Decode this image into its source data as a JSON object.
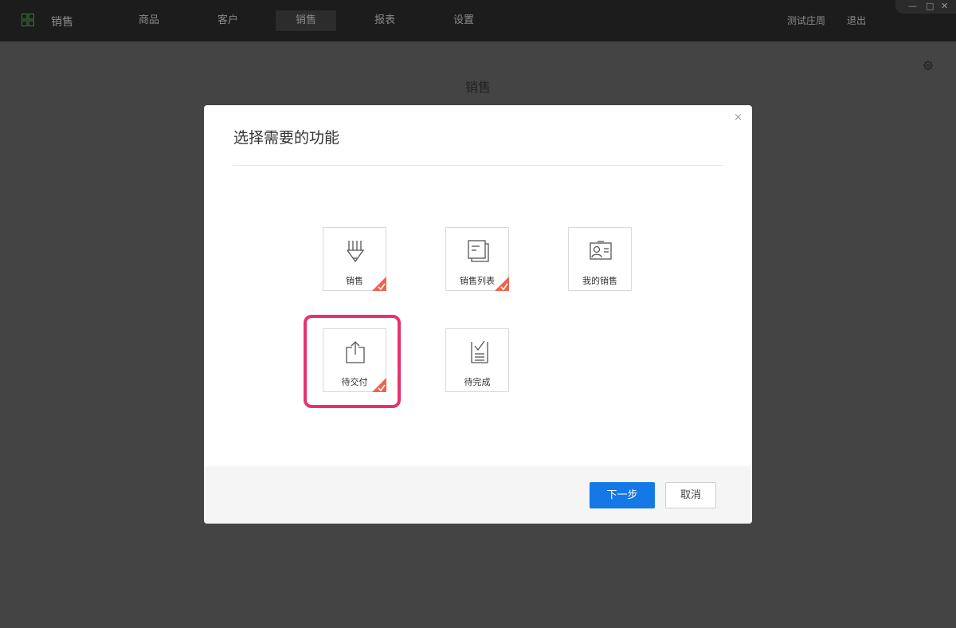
{
  "topbar": {
    "app_name": "销售",
    "nav": [
      "商品",
      "客户",
      "销售",
      "报表",
      "设置"
    ],
    "active_nav": "销售",
    "user": "测试庄周",
    "logout": "退出",
    "window_controls": [
      "—",
      "□",
      "✕"
    ]
  },
  "page": {
    "title": "销售",
    "settings_icon": "gear-icon"
  },
  "modal": {
    "title": "选择需要的功能",
    "close": "×",
    "cards": [
      {
        "label": "销售",
        "icon": "pencil-icon",
        "checked": true
      },
      {
        "label": "销售列表",
        "icon": "document-stack-icon",
        "checked": true
      },
      {
        "label": "我的销售",
        "icon": "id-card-icon",
        "checked": false
      },
      {
        "label": "待交付",
        "icon": "share-upload-icon",
        "checked": true,
        "highlighted": true
      },
      {
        "label": "待完成",
        "icon": "checklist-icon",
        "checked": false
      }
    ],
    "next_button": "下一步",
    "cancel_button": "取消"
  },
  "colors": {
    "primary": "#1479e6",
    "check_badge": "#f0624a",
    "highlight": "#e8316f",
    "overlay": "#444444",
    "topbar": "#1c1c1c"
  }
}
